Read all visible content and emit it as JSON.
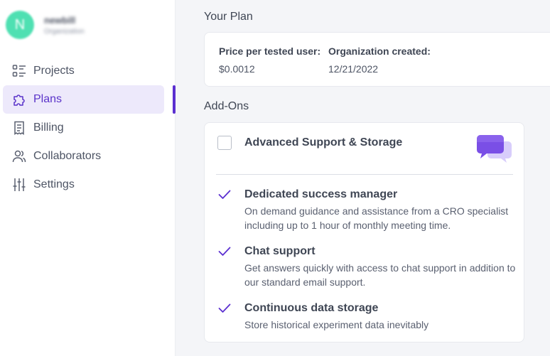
{
  "org": {
    "initial": "N",
    "name": "newbill",
    "subtitle": "Organization",
    "avatar_color": "#4fe0b2"
  },
  "nav": {
    "items": [
      {
        "label": "Projects",
        "icon": "list-icon"
      },
      {
        "label": "Plans",
        "icon": "puzzle-icon",
        "active": true
      },
      {
        "label": "Billing",
        "icon": "receipt-icon"
      },
      {
        "label": "Collaborators",
        "icon": "users-icon"
      },
      {
        "label": "Settings",
        "icon": "sliders-icon"
      }
    ]
  },
  "plan": {
    "title": "Your Plan",
    "price_label": "Price per tested user:",
    "price_value": "$0.0012",
    "created_label": "Organization created:",
    "created_value": "12/21/2022"
  },
  "addons": {
    "title": "Add-Ons",
    "item_title": "Advanced Support & Storage",
    "features": [
      {
        "title": "Dedicated success manager",
        "desc": "On demand guidance and assistance from a CRO specialist including up to 1 hour of monthly meeting time."
      },
      {
        "title": "Chat support",
        "desc": "Get answers quickly with access to chat support in addition to our standard email support."
      },
      {
        "title": "Continuous data storage",
        "desc": "Store historical experiment data inevitably"
      }
    ]
  },
  "colors": {
    "accent": "#5b2fd0",
    "active_bg": "#ede9fb"
  }
}
